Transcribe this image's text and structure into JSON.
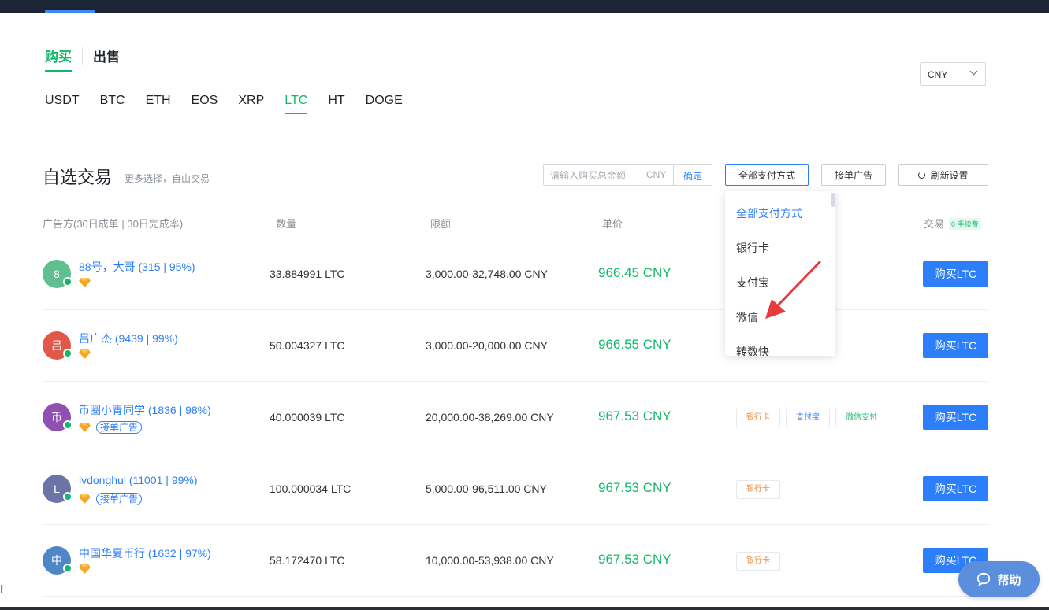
{
  "mode_tabs": {
    "buy": "购买",
    "sell": "出售"
  },
  "coin_tabs": [
    "USDT",
    "BTC",
    "ETH",
    "EOS",
    "XRP",
    "LTC",
    "HT",
    "DOGE"
  ],
  "active_coin": "LTC",
  "currency_select": {
    "value": "CNY"
  },
  "section": {
    "title": "自选交易",
    "subtitle": "更多选择，自由交易"
  },
  "amount_filter": {
    "placeholder": "请输入购买总金额",
    "unit": "CNY",
    "confirm": "确定"
  },
  "filters": {
    "payment_label": "全部支付方式",
    "ad_label": "接单广告",
    "refresh_label": "刷新设置"
  },
  "table_headers": {
    "advertiser": "广告方(30日成单 | 30日完成率)",
    "quantity": "数量",
    "limit": "限额",
    "price": "单价",
    "trade": "交易",
    "fee_badge": "0 手续费"
  },
  "rows": [
    {
      "avatar": "8",
      "avatar_color": "#5fbf8f",
      "name": "88号，大哥 (315 | 95%)",
      "ad_tag": "",
      "quantity": "33.884991 LTC",
      "limit": "3,000.00-32,748.00 CNY",
      "price": "966.45 CNY",
      "payments": [],
      "action": "购买LTC"
    },
    {
      "avatar": "吕",
      "avatar_color": "#e0584a",
      "name": "吕广杰 (9439 | 99%)",
      "ad_tag": "",
      "quantity": "50.004327 LTC",
      "limit": "3,000.00-20,000.00 CNY",
      "price": "966.55 CNY",
      "payments": [],
      "action": "购买LTC"
    },
    {
      "avatar": "币",
      "avatar_color": "#8f4fb3",
      "name": "币圈小青同学 (1836 | 98%)",
      "ad_tag": "接单广告",
      "quantity": "40.000039 LTC",
      "limit": "20,000.00-38,269.00 CNY",
      "price": "967.53 CNY",
      "payments": [
        "银行卡",
        "支付宝",
        "微信支付"
      ],
      "action": "购买LTC"
    },
    {
      "avatar": "L",
      "avatar_color": "#6b74a6",
      "name": "lvdonghui (11001 | 99%)",
      "ad_tag": "接单广告",
      "quantity": "100.000034 LTC",
      "limit": "5,000.00-96,511.00 CNY",
      "price": "967.53 CNY",
      "payments": [
        "银行卡"
      ],
      "action": "购买LTC"
    },
    {
      "avatar": "中",
      "avatar_color": "#4f86c6",
      "name": "中国华夏币行 (1632 | 97%)",
      "ad_tag": "",
      "quantity": "58.172470 LTC",
      "limit": "10,000.00-53,938.00 CNY",
      "price": "967.53 CNY",
      "payments": [
        "银行卡"
      ],
      "action": "购买LTC"
    }
  ],
  "payment_dropdown": {
    "items": [
      "全部支付方式",
      "银行卡",
      "支付宝",
      "微信",
      "转数快"
    ],
    "selected": "全部支付方式"
  },
  "help": {
    "label": "帮助"
  },
  "colors": {
    "accent_green": "#14b86c",
    "accent_blue": "#2d7ff9",
    "topbar": "#1b2536",
    "bank": "#f08c3a"
  }
}
